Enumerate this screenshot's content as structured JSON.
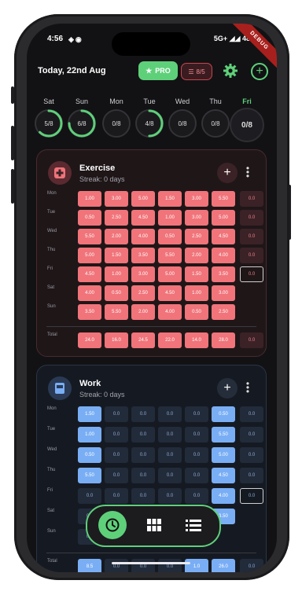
{
  "status": {
    "time": "4:56",
    "network": "5G+",
    "battery": "48%"
  },
  "debug_banner": "DEBUG",
  "header": {
    "date": "Today, 22nd Aug",
    "pro_label": "PRO",
    "counter_label": "8/5"
  },
  "days": [
    {
      "label": "Sat",
      "value": "5/8",
      "progress": 0.625
    },
    {
      "label": "Sun",
      "value": "6/8",
      "progress": 0.75
    },
    {
      "label": "Mon",
      "value": "0/8",
      "progress": 0
    },
    {
      "label": "Tue",
      "value": "4/8",
      "progress": 0.5
    },
    {
      "label": "Wed",
      "value": "0/8",
      "progress": 0
    },
    {
      "label": "Thu",
      "value": "0/8",
      "progress": 0
    },
    {
      "label": "Fri",
      "value": "0/8",
      "progress": 0
    }
  ],
  "colors": {
    "accent": "#5fd07a",
    "exercise": "#f0747a",
    "work": "#79aef5"
  },
  "cards": [
    {
      "title": "Exercise",
      "streak": "Streak: 0 days",
      "theme": "red",
      "rows": [
        {
          "label": "Mon",
          "cells": [
            "1.00",
            "3.00",
            "5.00",
            "1.50",
            "3.00",
            "5.50",
            "0.0"
          ]
        },
        {
          "label": "Tue",
          "cells": [
            "0.50",
            "2.50",
            "4.50",
            "1.00",
            "3.00",
            "5.00",
            "0.0"
          ]
        },
        {
          "label": "Wed",
          "cells": [
            "5.50",
            "2.00",
            "4.00",
            "0.50",
            "2.50",
            "4.50",
            "0.0"
          ]
        },
        {
          "label": "Thu",
          "cells": [
            "5.00",
            "1.50",
            "3.50",
            "5.50",
            "2.00",
            "4.00",
            "0.0"
          ]
        },
        {
          "label": "Fri",
          "cells": [
            "4.50",
            "1.00",
            "3.00",
            "5.00",
            "1.50",
            "3.50",
            "0.0"
          ]
        },
        {
          "label": "Sat",
          "cells": [
            "4.00",
            "0.50",
            "2.50",
            "4.50",
            "1.00",
            "3.00",
            ""
          ]
        },
        {
          "label": "Sun",
          "cells": [
            "3.50",
            "5.50",
            "2.00",
            "4.00",
            "0.50",
            "2.50",
            ""
          ]
        }
      ],
      "total": {
        "label": "Total",
        "cells": [
          "24.0",
          "16.0",
          "24.5",
          "22.0",
          "14.0",
          "28.0",
          "0.0"
        ]
      }
    },
    {
      "title": "Work",
      "streak": "Streak: 0 days",
      "theme": "blue",
      "rows": [
        {
          "label": "Mon",
          "cells": [
            "1.50",
            "0.0",
            "0.0",
            "0.0",
            "0.0",
            "0.50",
            "0.0"
          ]
        },
        {
          "label": "Tue",
          "cells": [
            "1.00",
            "0.0",
            "0.0",
            "0.0",
            "0.0",
            "5.50",
            "0.0"
          ]
        },
        {
          "label": "Wed",
          "cells": [
            "0.50",
            "0.0",
            "0.0",
            "0.0",
            "0.0",
            "5.00",
            "0.0"
          ]
        },
        {
          "label": "Thu",
          "cells": [
            "5.50",
            "0.0",
            "0.0",
            "0.0",
            "0.0",
            "4.50",
            "0.0"
          ]
        },
        {
          "label": "Fri",
          "cells": [
            "0.0",
            "0.0",
            "0.0",
            "0.0",
            "0.0",
            "4.00",
            "0.0"
          ]
        },
        {
          "label": "Sat",
          "cells": [
            "0.0",
            "",
            "",
            "",
            "",
            "3.50",
            ""
          ]
        },
        {
          "label": "Sun",
          "cells": [
            "0.0",
            "",
            "",
            "",
            "",
            "",
            ""
          ]
        }
      ],
      "total": {
        "label": "Total",
        "cells": [
          "8.5",
          "0.0",
          "0.0",
          "0.0",
          "1.0",
          "26.0",
          "0.0"
        ]
      }
    }
  ],
  "bottom_nav": {
    "items": [
      "clock-icon",
      "grid-icon",
      "list-icon"
    ]
  }
}
